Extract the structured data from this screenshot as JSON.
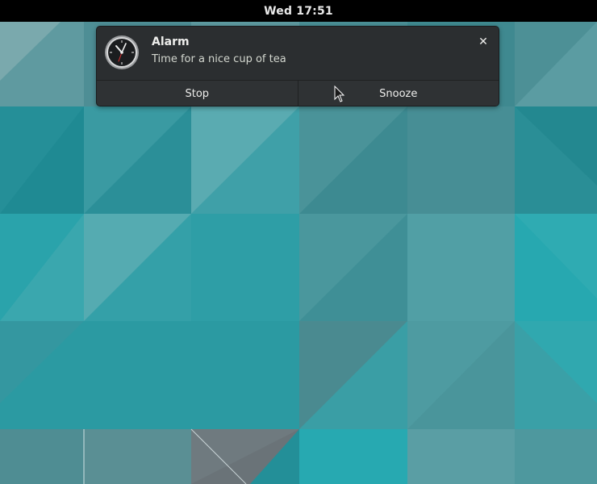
{
  "topbar": {
    "clock": "Wed 17:51"
  },
  "notification": {
    "app_icon": "clock-icon",
    "title": "Alarm",
    "body": "Time for a nice cup of tea",
    "close_icon": "close-icon",
    "close_glyph": "✕",
    "actions": [
      {
        "label": "Stop"
      },
      {
        "label": "Snooze"
      }
    ]
  },
  "colors": {
    "topbar": "#000000",
    "notification_bg": "#2b2e30",
    "wallpaper_base": "#2e9aa2"
  }
}
